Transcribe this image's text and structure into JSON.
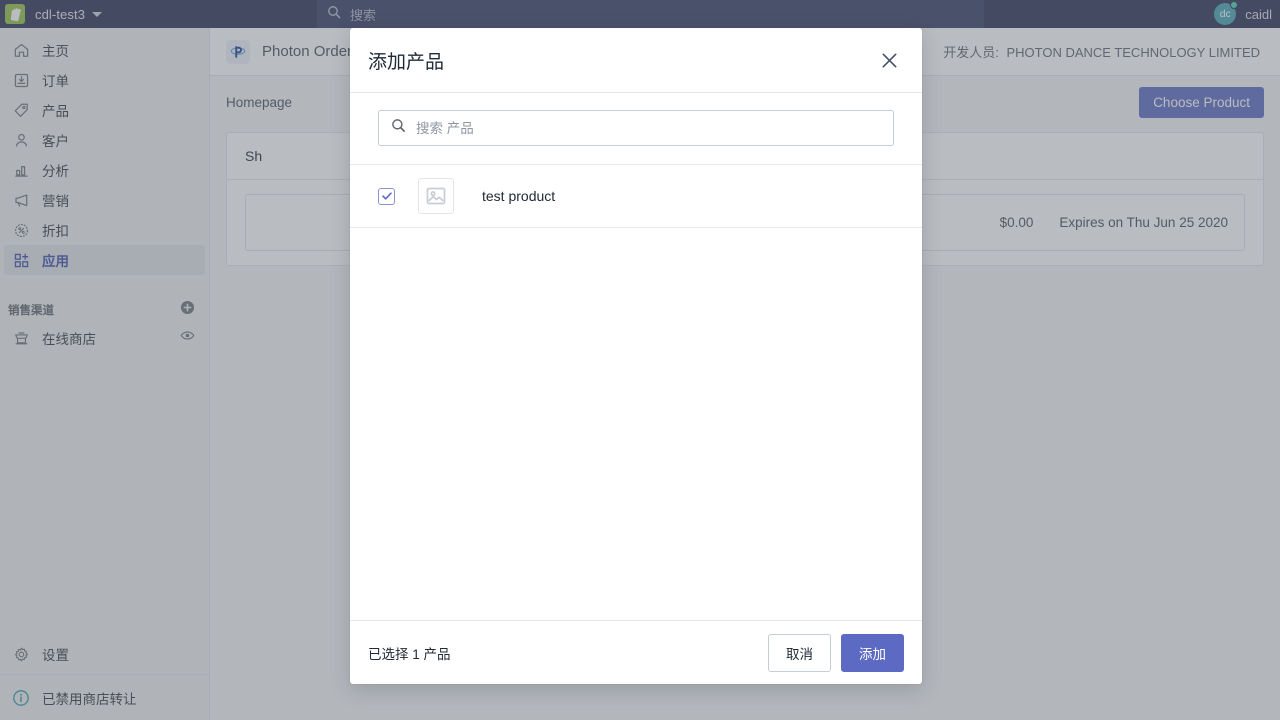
{
  "topbar": {
    "shop_name": "cdl-test3",
    "search_placeholder": "搜索",
    "search_icon": "search-icon",
    "caret_icon": "chevron-down-icon",
    "logo_icon": "shopify-logo-icon",
    "user": {
      "initials": "dc",
      "name": "caidl",
      "status_dot_color": "#4ad6a8"
    }
  },
  "sidebar": {
    "items": [
      {
        "label": "主页",
        "icon": "home-icon",
        "active": false
      },
      {
        "label": "订单",
        "icon": "orders-inbox-icon",
        "active": false
      },
      {
        "label": "产品",
        "icon": "tag-icon",
        "active": false
      },
      {
        "label": "客户",
        "icon": "customer-person-icon",
        "active": false
      },
      {
        "label": "分析",
        "icon": "analytics-bar-chart-icon",
        "active": false
      },
      {
        "label": "营销",
        "icon": "marketing-megaphone-icon",
        "active": false
      },
      {
        "label": "折扣",
        "icon": "discount-percent-icon",
        "active": false
      },
      {
        "label": "应用",
        "icon": "apps-grid-plus-icon",
        "active": true
      }
    ],
    "section": {
      "title": "销售渠道",
      "add_icon": "add-circle-icon",
      "channels": [
        {
          "label": "在线商店",
          "icon": "online-store-icon",
          "action_icon": "eye-icon"
        }
      ]
    },
    "bottom": [
      {
        "label": "设置",
        "icon": "gear-icon"
      },
      {
        "label": "已禁用商店转让",
        "icon": "info-circle-icon"
      }
    ]
  },
  "app_header": {
    "app_icon": "photon-order-app-icon",
    "app_title": "Photon Order",
    "developer_label": "开发人员:",
    "developer_name": "PHOTON DANCE TECHNOLOGY LIMITED"
  },
  "content": {
    "breadcrumb": "Homepage",
    "choose_product_button": "Choose Product",
    "card_title": "Sh",
    "price": "$0.00",
    "expiry": "Expires on Thu Jun 25 2020"
  },
  "modal": {
    "title": "添加产品",
    "close_icon": "close-icon",
    "search": {
      "icon": "search-icon",
      "placeholder": "搜索 产品",
      "value": ""
    },
    "products": [
      {
        "name": "test product",
        "checked": true,
        "thumbnail_icon": "image-placeholder-icon"
      }
    ],
    "footer": {
      "status": "已选择 1 产品",
      "cancel_label": "取消",
      "add_label": "添加"
    }
  },
  "colors": {
    "topbar_bg": "#2b3155",
    "sidebar_bg": "#eef0f3",
    "accent_purple": "#5c6ac4",
    "active_nav_text": "#3f4eae",
    "avatar_bg": "#47a3b5"
  }
}
